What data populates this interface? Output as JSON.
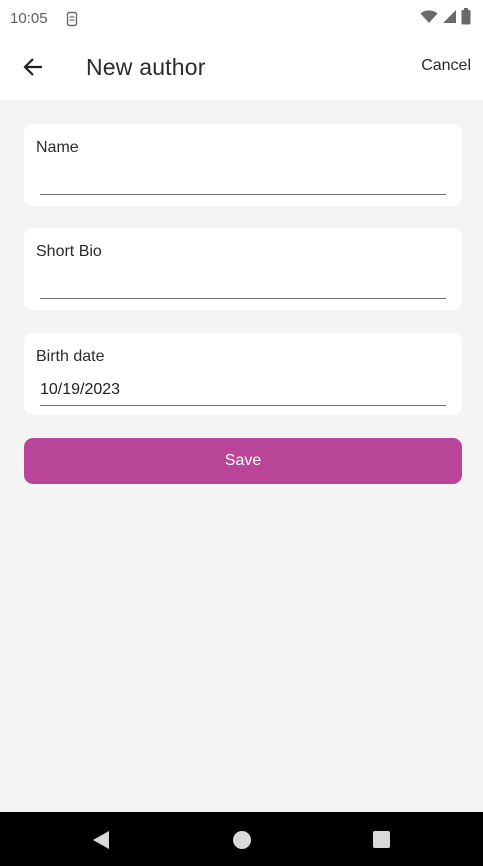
{
  "status_bar": {
    "time": "10:05",
    "icons": [
      "sim-card-icon",
      "wifi-icon",
      "signal-icon",
      "battery-icon"
    ]
  },
  "app_bar": {
    "back_icon": "arrow-left-icon",
    "title": "New author",
    "cancel_label": "Cancel"
  },
  "form": {
    "name": {
      "label": "Name",
      "value": ""
    },
    "short_bio": {
      "label": "Short Bio",
      "value": ""
    },
    "birth_date": {
      "label": "Birth date",
      "value": "10/19/2023"
    },
    "save_label": "Save"
  },
  "colors": {
    "accent": "#b84597",
    "background": "#f4f4f4",
    "card": "#ffffff"
  },
  "nav_bar": {
    "icons": [
      "nav-back-icon",
      "nav-home-icon",
      "nav-recent-icon"
    ]
  }
}
